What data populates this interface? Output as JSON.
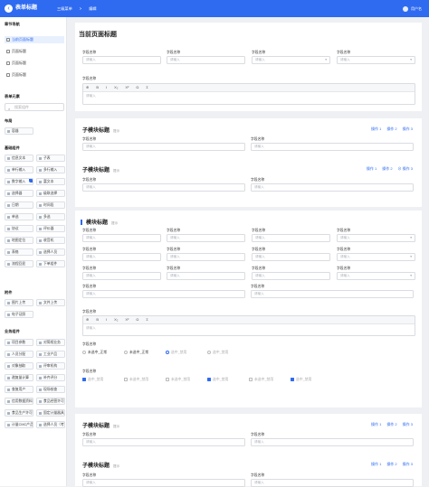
{
  "app": {
    "title": "表单标题",
    "breadcrumb": [
      "三级菜单",
      ">",
      "编辑"
    ],
    "user": "用户名"
  },
  "sidebar": {
    "h_section": "章节导航",
    "section_items": [
      "当前页面标题",
      "页面标题",
      "页面标题",
      "页面标题"
    ],
    "h_elements": "表单元素",
    "search_placeholder": "搜索组件",
    "h_layout": "布局",
    "layout_items": [
      "容器"
    ],
    "h_basic": "基础组件",
    "basic_items": [
      "信息文本",
      "子表",
      "单行输入",
      "多行输入",
      "数字输入",
      "富文本",
      "选择器",
      "级联选择",
      "日期",
      "时间段",
      "单选",
      "多选",
      "协议",
      "评价器",
      "地图定位",
      "收音机",
      "表格",
      "选择人员",
      "流程回显",
      "下单组件"
    ],
    "h_upload": "附件",
    "upload_items": [
      "图片上传",
      "文件上传",
      "电子证照"
    ],
    "h_business": "业务组件",
    "business_items": [
      "项目参数",
      "对简框业务",
      "人员分配",
      "工业产品",
      "对象抽取",
      "评审机构",
      "邀复量计算",
      "补齐评分",
      "查复用户",
      "现场核查",
      "信用数据资料",
      "食品经营许可",
      "食品生产许可",
      "固定计量器具",
      "计量CMC产品",
      "选择人员（考核准备）"
    ]
  },
  "page": {
    "title": "当前页面标题",
    "field_label": "字段名称",
    "placeholder": "请输入",
    "rte_label": "字段名称",
    "rte_toolbar": [
      "⊕",
      "B",
      "I",
      "X₂",
      "X²",
      "Ω",
      "Σ"
    ],
    "rte_placeholder": "请输入",
    "sub1": {
      "title": "子模块标题",
      "hint": "提示",
      "actions": [
        "操作 1",
        "操作 2",
        "操作 3"
      ]
    },
    "sub2": {
      "title": "子模块标题",
      "hint": "提示",
      "actions": [
        "操作 1",
        "操作 2",
        "⊘ 操作 3"
      ]
    },
    "mod": {
      "title": "模块标题",
      "hint": "提示"
    },
    "radio_label": "字段名称",
    "radios": [
      "未选中_正常",
      "未选中_正常",
      "选中_禁用",
      "选中_禁用"
    ],
    "check_label": "字段名称",
    "checks": [
      "选中_禁用",
      "未选中_禁用",
      "未选中_禁用",
      "选中_禁用",
      "未选中_禁用",
      "选中_禁用"
    ],
    "sub3": {
      "title": "子模块标题",
      "hint": "提示",
      "actions": [
        "操作 1",
        "操作 2",
        "操作 3"
      ]
    },
    "sub4": {
      "title": "子模块标题",
      "hint": "提示",
      "actions": [
        "操作 1",
        "操作 2",
        "操作 3"
      ]
    }
  },
  "colors": {
    "accent": "#2f6bf0"
  }
}
